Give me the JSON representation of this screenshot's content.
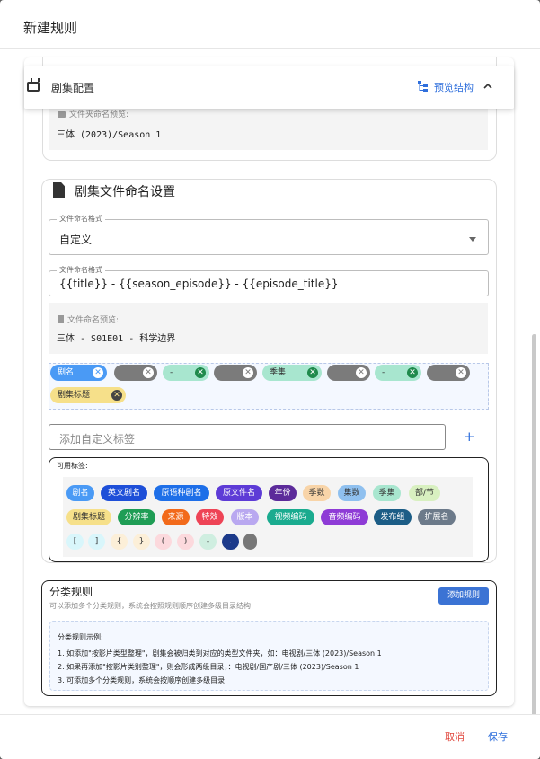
{
  "dialog": {
    "title": "新建规则"
  },
  "panel": {
    "title": "剧集配置",
    "preview_label": "预览结构"
  },
  "folder_preview": {
    "label": "文件夹命名预览:",
    "value": "三体 (2023)/Season 1"
  },
  "file_naming": {
    "heading": "剧集文件命名设置",
    "format_legend": "文件命名格式",
    "format_value": "自定义",
    "template_legend": "文件命名格式",
    "template_value": "{{title}} - {{season_episode}} - {{episode_title}}",
    "preview_label": "文件命名预览:",
    "preview_value": "三体 - S01E01 - 科学边界"
  },
  "selected_chips": [
    {
      "label": "剧名",
      "color": "#4a9af5"
    },
    {
      "label": "",
      "color": "#7b7b7b"
    },
    {
      "label": "-",
      "color": "#a8e6cf"
    },
    {
      "label": "",
      "color": "#7b7b7b"
    },
    {
      "label": "季集",
      "color": "#a8e6cf"
    },
    {
      "label": "",
      "color": "#7b7b7b"
    },
    {
      "label": "-",
      "color": "#a8e6cf"
    },
    {
      "label": "",
      "color": "#7b7b7b"
    },
    {
      "label": "剧集标题",
      "color": "#f6e08a"
    }
  ],
  "custom_tag": {
    "placeholder": "添加自定义标签",
    "add_label": "+"
  },
  "available": {
    "title": "可用标签:",
    "tags": [
      {
        "label": "剧名",
        "bg": "#4a9af5",
        "fg": "#fff"
      },
      {
        "label": "英文剧名",
        "bg": "#1e4fd8",
        "fg": "#fff"
      },
      {
        "label": "原语种剧名",
        "bg": "#1e6fe8",
        "fg": "#fff"
      },
      {
        "label": "原文件名",
        "bg": "#5d3bd6",
        "fg": "#fff"
      },
      {
        "label": "年份",
        "bg": "#5c2b9a",
        "fg": "#fff"
      },
      {
        "label": "季数",
        "bg": "#f8d4a8",
        "fg": "#333"
      },
      {
        "label": "集数",
        "bg": "#8fc0ef",
        "fg": "#333"
      },
      {
        "label": "季集",
        "bg": "#a8e6cf",
        "fg": "#333"
      },
      {
        "label": "部/节",
        "bg": "#d8f0c0",
        "fg": "#333"
      },
      {
        "label": "剧集标题",
        "bg": "#f6e08a",
        "fg": "#333"
      },
      {
        "label": "分辨率",
        "bg": "#1f9d55",
        "fg": "#fff"
      },
      {
        "label": "来源",
        "bg": "#f26a1b",
        "fg": "#fff"
      },
      {
        "label": "特效",
        "bg": "#ee4456",
        "fg": "#fff"
      },
      {
        "label": "版本",
        "bg": "#b9a8f0",
        "fg": "#fff"
      },
      {
        "label": "视频编码",
        "bg": "#1aab8f",
        "fg": "#fff"
      },
      {
        "label": "音频编码",
        "bg": "#8e3bd6",
        "fg": "#fff"
      },
      {
        "label": "发布组",
        "bg": "#1c5d86",
        "fg": "#fff"
      },
      {
        "label": "扩展名",
        "bg": "#6c7a8a",
        "fg": "#fff"
      },
      {
        "label": "[",
        "bg": "#d9f6fb",
        "fg": "#333"
      },
      {
        "label": "]",
        "bg": "#d9f6fb",
        "fg": "#333"
      },
      {
        "label": "{",
        "bg": "#fcefd8",
        "fg": "#333"
      },
      {
        "label": "}",
        "bg": "#fcefd8",
        "fg": "#333"
      },
      {
        "label": "(",
        "bg": "#fcd9dd",
        "fg": "#333"
      },
      {
        "label": ")",
        "bg": "#fcd9dd",
        "fg": "#333"
      },
      {
        "label": "-",
        "bg": "#cfeee0",
        "fg": "#333"
      },
      {
        "label": ".",
        "bg": "#1c3a8a",
        "fg": "#fff"
      },
      {
        "label": "",
        "bg": "#777",
        "fg": "#fff"
      }
    ]
  },
  "classification": {
    "heading": "分类规则",
    "subtitle": "可以添加多个分类规则，系统会按照规则顺序创建多级目录结构",
    "add_button": "添加规则",
    "example_title": "分类规则示例:",
    "example_lines": [
      "1. 如添加\"按影片类型整理\"，剧集会被归类到对应的类型文件夹，如：电视剧/三体 (2023)/Season 1",
      "2. 如果再添加\"按影片类别整理\"，则会形成两级目录，：电视剧/国产剧/三体 (2023)/Season 1",
      "3. 可添加多个分类规则，系统会按顺序创建多级目录"
    ]
  },
  "footer": {
    "cancel": "取消",
    "save": "保存"
  }
}
